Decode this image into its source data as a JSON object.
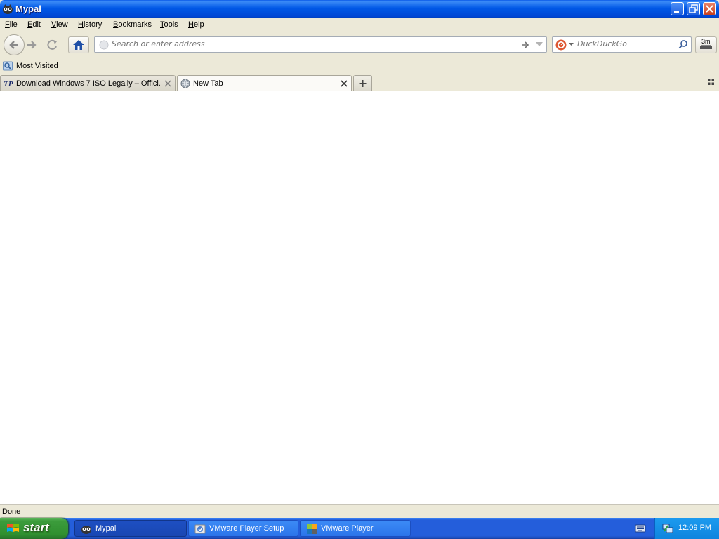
{
  "window": {
    "title": "Mypal"
  },
  "menu": [
    "File",
    "Edit",
    "View",
    "History",
    "Bookmarks",
    "Tools",
    "Help"
  ],
  "navbar": {
    "url_placeholder": "Search or enter address",
    "search_placeholder": "DuckDuckGo",
    "side_button_label": "3m"
  },
  "bookmarks": {
    "items": [
      {
        "label": "Most Visited",
        "icon": "bookmark-folder-icon"
      }
    ]
  },
  "tabs": [
    {
      "label": "Download Windows 7 ISO Legally – Offici...",
      "icon": "tp-favicon",
      "active": false
    },
    {
      "label": "New Tab",
      "icon": "globe-icon",
      "active": true
    }
  ],
  "status": {
    "text": "Done"
  },
  "taskbar": {
    "start_label": "start",
    "tasks": [
      {
        "label": "Mypal",
        "icon": "mypal-icon",
        "active": true
      },
      {
        "label": "VMware Player Setup",
        "icon": "installer-icon",
        "active": false
      },
      {
        "label": "VMware Player",
        "icon": "vmware-icon",
        "active": false
      }
    ],
    "clock": "12:09 PM"
  },
  "colors": {
    "titlebar": "#0058e6",
    "taskbar": "#245edb",
    "start": "#3c9c3c",
    "tray": "#0f84de"
  }
}
